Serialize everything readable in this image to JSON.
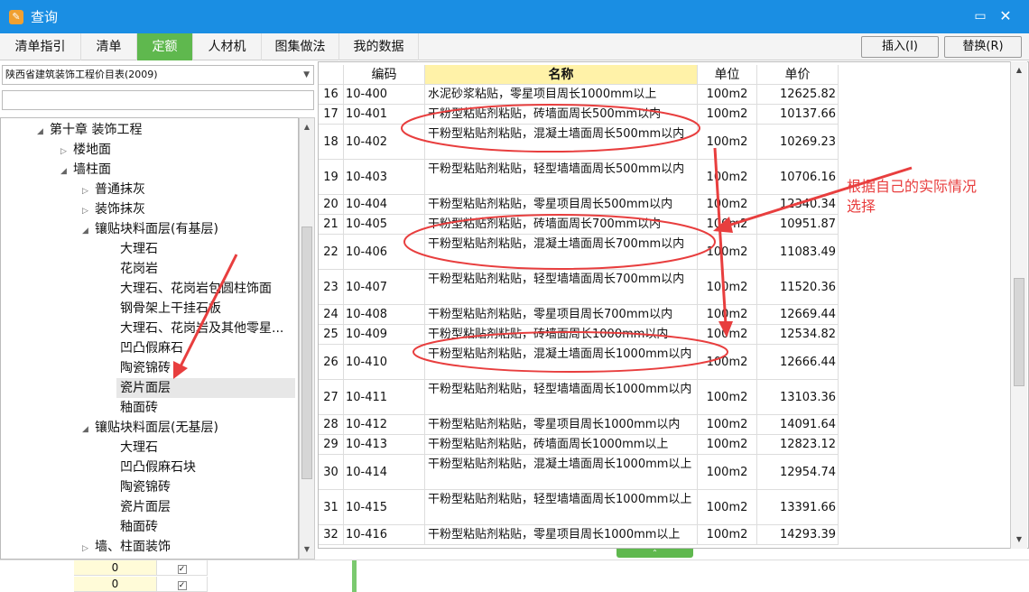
{
  "window": {
    "title": "查询",
    "icon": "app-icon"
  },
  "tabs": [
    {
      "label": "清单指引",
      "active": false
    },
    {
      "label": "清单",
      "active": false
    },
    {
      "label": "定额",
      "active": true
    },
    {
      "label": "人材机",
      "active": false
    },
    {
      "label": "图集做法",
      "active": false
    },
    {
      "label": "我的数据",
      "active": false
    }
  ],
  "actions": {
    "insert": "插入(I)",
    "replace": "替换(R)"
  },
  "library": {
    "selected": "陕西省建筑装饰工程价目表(2009)"
  },
  "tree": [
    {
      "label": "第十章 装饰工程",
      "level": 0,
      "state": "expanded"
    },
    {
      "label": "楼地面",
      "level": 1,
      "state": "collapsed"
    },
    {
      "label": "墙柱面",
      "level": 1,
      "state": "expanded"
    },
    {
      "label": "普通抹灰",
      "level": 2,
      "state": "collapsed"
    },
    {
      "label": "装饰抹灰",
      "level": 2,
      "state": "collapsed"
    },
    {
      "label": "镶贴块料面层(有基层)",
      "level": 2,
      "state": "expanded"
    },
    {
      "label": "大理石",
      "level": 3,
      "state": "leaf"
    },
    {
      "label": "花岗岩",
      "level": 3,
      "state": "leaf"
    },
    {
      "label": "大理石、花岗岩包圆柱饰面",
      "level": 3,
      "state": "leaf"
    },
    {
      "label": "钢骨架上干挂石板",
      "level": 3,
      "state": "leaf"
    },
    {
      "label": "大理石、花岗岩及其他零星...",
      "level": 3,
      "state": "leaf"
    },
    {
      "label": "凹凸假麻石",
      "level": 3,
      "state": "leaf"
    },
    {
      "label": "陶瓷锦砖",
      "level": 3,
      "state": "leaf"
    },
    {
      "label": "瓷片面层",
      "level": 3,
      "state": "leaf",
      "selected": true
    },
    {
      "label": "釉面砖",
      "level": 3,
      "state": "leaf"
    },
    {
      "label": "镶贴块料面层(无基层)",
      "level": 2,
      "state": "expanded"
    },
    {
      "label": "大理石",
      "level": 3,
      "state": "leaf"
    },
    {
      "label": "凹凸假麻石块",
      "level": 3,
      "state": "leaf"
    },
    {
      "label": "陶瓷锦砖",
      "level": 3,
      "state": "leaf"
    },
    {
      "label": "瓷片面层",
      "level": 3,
      "state": "leaf"
    },
    {
      "label": "釉面砖",
      "level": 3,
      "state": "leaf"
    },
    {
      "label": "墙、柱面装饰",
      "level": 2,
      "state": "collapsed"
    }
  ],
  "grid": {
    "headers": [
      "编码",
      "名称",
      "单位",
      "单价"
    ],
    "rows": [
      {
        "idx": "16",
        "code": "10-400",
        "name": "水泥砂浆粘贴，零星项目周长1000mm以上",
        "unit": "100m2",
        "price": "12625.82",
        "tall": false
      },
      {
        "idx": "17",
        "code": "10-401",
        "name": "干粉型粘贴剂粘贴，砖墙面周长500mm以内",
        "unit": "100m2",
        "price": "10137.66",
        "tall": false
      },
      {
        "idx": "18",
        "code": "10-402",
        "name": "干粉型粘贴剂粘贴，混凝土墙面周长500mm以内",
        "unit": "100m2",
        "price": "10269.23",
        "tall": true
      },
      {
        "idx": "19",
        "code": "10-403",
        "name": "干粉型粘贴剂粘贴，轻型墙墙面周长500mm以内",
        "unit": "100m2",
        "price": "10706.16",
        "tall": true
      },
      {
        "idx": "20",
        "code": "10-404",
        "name": "干粉型粘贴剂粘贴，零星项目周长500mm以内",
        "unit": "100m2",
        "price": "12340.34",
        "tall": false
      },
      {
        "idx": "21",
        "code": "10-405",
        "name": "干粉型粘贴剂粘贴，砖墙面周长700mm以内",
        "unit": "100m2",
        "price": "10951.87",
        "tall": false
      },
      {
        "idx": "22",
        "code": "10-406",
        "name": "干粉型粘贴剂粘贴，混凝土墙面周长700mm以内",
        "unit": "100m2",
        "price": "11083.49",
        "tall": true
      },
      {
        "idx": "23",
        "code": "10-407",
        "name": "干粉型粘贴剂粘贴，轻型墙墙面周长700mm以内",
        "unit": "100m2",
        "price": "11520.36",
        "tall": true
      },
      {
        "idx": "24",
        "code": "10-408",
        "name": "干粉型粘贴剂粘贴，零星项目周长700mm以内",
        "unit": "100m2",
        "price": "12669.44",
        "tall": false
      },
      {
        "idx": "25",
        "code": "10-409",
        "name": "干粉型粘贴剂粘贴，砖墙面周长1000mm以内",
        "unit": "100m2",
        "price": "12534.82",
        "tall": false
      },
      {
        "idx": "26",
        "code": "10-410",
        "name": "干粉型粘贴剂粘贴，混凝土墙面周长1000mm以内",
        "unit": "100m2",
        "price": "12666.44",
        "tall": true
      },
      {
        "idx": "27",
        "code": "10-411",
        "name": "干粉型粘贴剂粘贴，轻型墙墙面周长1000mm以内",
        "unit": "100m2",
        "price": "13103.36",
        "tall": true
      },
      {
        "idx": "28",
        "code": "10-412",
        "name": "干粉型粘贴剂粘贴，零星项目周长1000mm以内",
        "unit": "100m2",
        "price": "14091.64",
        "tall": false
      },
      {
        "idx": "29",
        "code": "10-413",
        "name": "干粉型粘贴剂粘贴，砖墙面周长1000mm以上",
        "unit": "100m2",
        "price": "12823.12",
        "tall": false
      },
      {
        "idx": "30",
        "code": "10-414",
        "name": "干粉型粘贴剂粘贴，混凝土墙面周长1000mm以上",
        "unit": "100m2",
        "price": "12954.74",
        "tall": true
      },
      {
        "idx": "31",
        "code": "10-415",
        "name": "干粉型粘贴剂粘贴，轻型墙墙面周长1000mm以上",
        "unit": "100m2",
        "price": "13391.66",
        "tall": true
      },
      {
        "idx": "32",
        "code": "10-416",
        "name": "干粉型粘贴剂粘贴，零星项目周长1000mm以上",
        "unit": "100m2",
        "price": "14293.39",
        "tall": false
      }
    ]
  },
  "annotation": {
    "text_line1": "根据自己的实际情况",
    "text_line2": "选择",
    "color": "#e83e3e"
  },
  "background_sheet": {
    "values": [
      "0",
      "0"
    ]
  },
  "colors": {
    "titlebar": "#1a8ee3",
    "active_tab": "#5fb84e",
    "name_header": "#fff2a8"
  }
}
